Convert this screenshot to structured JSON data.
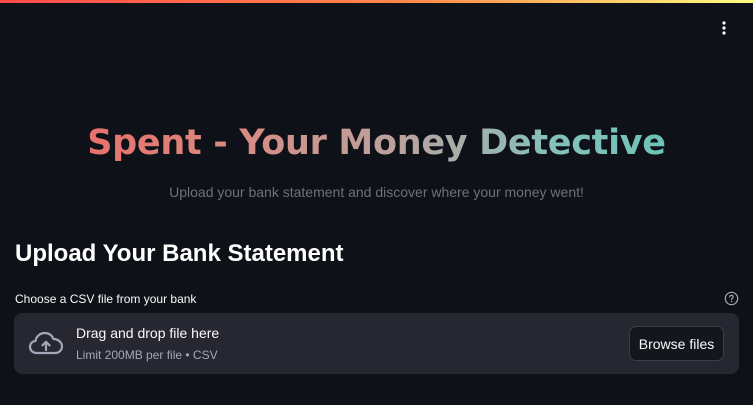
{
  "header": {
    "menu_icon": "more-vertical-icon",
    "decoration_colors": [
      "#ff4b4b",
      "#ff8a4b",
      "#fffd80"
    ]
  },
  "hero": {
    "title": "Spent - Your Money Detective",
    "subtitle": "Upload your bank statement and discover where your money went!",
    "title_gradient": [
      "#e8706b",
      "#b9a39f",
      "#6cc3b8"
    ]
  },
  "main": {
    "section_title": "Upload Your Bank Statement",
    "uploader": {
      "label": "Choose a CSV file from your bank",
      "help_icon": "help-circle-icon",
      "upload_icon": "cloud-upload-icon",
      "drop_text": "Drag and drop file here",
      "limit_text": "Limit 200MB per file • CSV",
      "browse_label": "Browse files"
    }
  }
}
